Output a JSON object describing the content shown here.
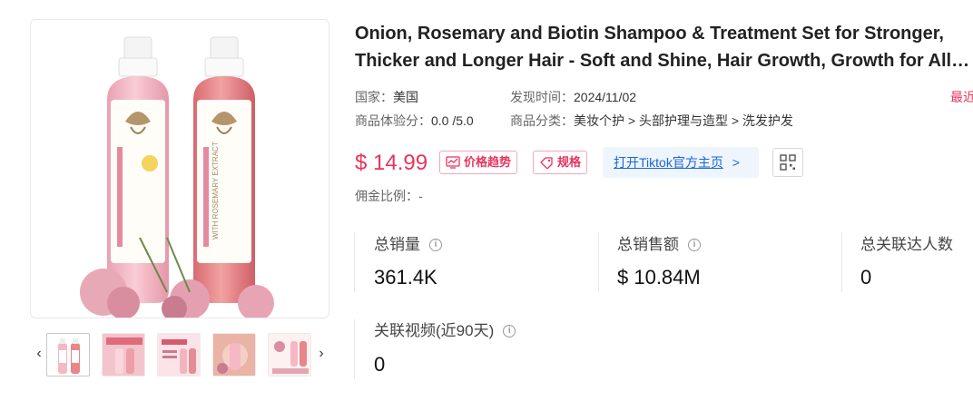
{
  "product": {
    "title_line1": "Onion, Rosemary and Biotin Shampoo & Treatment Set for Stronger,",
    "title_line2": "Thicker and Longer Hair - Soft and Shine, Hair Growth, Growth for All Hai...",
    "country_label": "国家：",
    "country_value": "美国",
    "discovered_label": "发现时间：",
    "discovered_value": "2024/11/02",
    "recent_tag": "最近",
    "score_label": "商品体验分：",
    "score_value": "0.0 /5.0",
    "category_label": "商品分类：",
    "category_value": "美妆个护 > 头部护理与造型 > 洗发护发",
    "price": "$ 14.99",
    "price_trend_label": "价格趋势",
    "spec_label": "规格",
    "tiktok_link_label": "打开Tiktok官方主页",
    "tiktok_arrow": ">",
    "commission_label": "佣金比例：",
    "commission_value": "-",
    "bottle_text": "WITH ROSEMARY EXTRACT"
  },
  "stats": {
    "total_sales_label": "总销量",
    "total_sales_value": "361.4K",
    "total_revenue_label": "总销售额",
    "total_revenue_value": "$ 10.84M",
    "total_creators_label": "总关联达人数",
    "total_creators_value": "0",
    "videos_label": "关联视频(近90天)",
    "videos_value": "0"
  },
  "gallery": {
    "prev_arrow": "‹",
    "next_arrow": "›",
    "thumb_count": 5
  },
  "colors": {
    "price_red": "#e8345c",
    "link_blue": "#1a66d9",
    "link_bg": "#eef5fd",
    "bottle_pink": "#f5b8c4",
    "bottle_red": "#e8868a"
  },
  "icons": {
    "info": "info-icon",
    "trend": "trend-chart-icon",
    "tag": "tag-icon",
    "qr": "qr-code-icon",
    "prev": "chevron-left-icon",
    "next": "chevron-right-icon"
  }
}
